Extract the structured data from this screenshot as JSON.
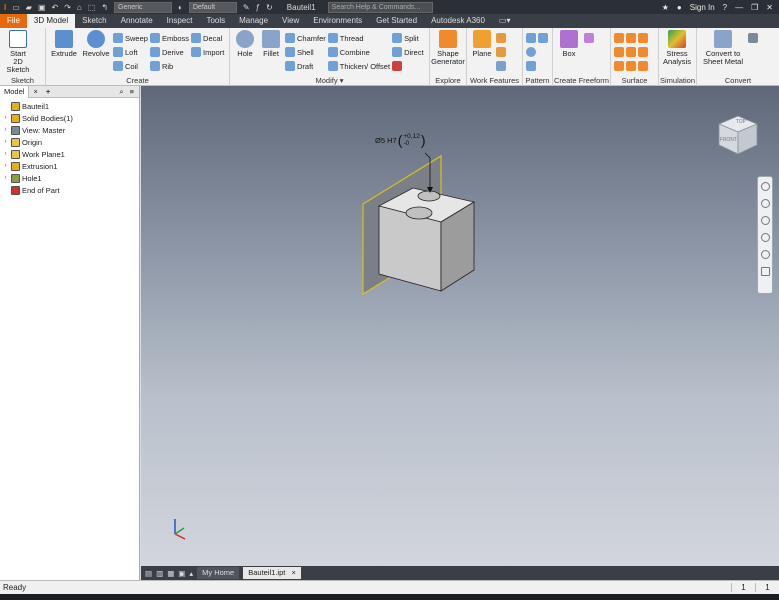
{
  "titlebar": {
    "appearance_select": "Generic",
    "material_select": "Default",
    "doc_title": "Bauteil1",
    "search_placeholder": "Search Help & Commands...",
    "sign_in": "Sign In",
    "help": "?"
  },
  "ribbon_tabs": [
    "File",
    "3D Model",
    "Sketch",
    "Annotate",
    "Inspect",
    "Tools",
    "Manage",
    "View",
    "Environments",
    "Get Started",
    "Autodesk A360"
  ],
  "panels": {
    "sketch": {
      "title": "Sketch",
      "start_label": "Start\n2D Sketch"
    },
    "create": {
      "title": "Create",
      "extrude": "Extrude",
      "revolve": "Revolve",
      "sweep": "Sweep",
      "loft": "Loft",
      "coil": "Coil",
      "emboss": "Emboss",
      "derive": "Derive",
      "rib": "Rib",
      "decal": "Decal",
      "import": "Import"
    },
    "modify": {
      "title": "Modify ▾",
      "hole": "Hole",
      "fillet": "Fillet",
      "chamfer": "Chamfer",
      "shell": "Shell",
      "draft": "Draft",
      "thread": "Thread",
      "combine": "Combine",
      "thicken": "Thicken/ Offset",
      "split": "Split",
      "direct": "Direct"
    },
    "explore": {
      "title": "Explore",
      "shape_generator": "Shape\nGenerator"
    },
    "work_features": {
      "title": "Work Features",
      "plane": "Plane"
    },
    "pattern": {
      "title": "Pattern"
    },
    "freeform": {
      "title": "Create Freeform",
      "box": "Box"
    },
    "surface": {
      "title": "Surface"
    },
    "simulation": {
      "title": "Simulation",
      "stress": "Stress\nAnalysis"
    },
    "convert": {
      "title": "Convert",
      "sheet_metal": "Convert to\nSheet Metal"
    }
  },
  "browser": {
    "tab": "Model",
    "close": "×",
    "add": "+",
    "nodes": [
      {
        "label": "Bauteil1",
        "color": "#e0b020",
        "exp": ""
      },
      {
        "label": "Solid Bodies(1)",
        "color": "#e0b020",
        "exp": "›"
      },
      {
        "label": "View: Master",
        "color": "#7a8a9a",
        "exp": "›"
      },
      {
        "label": "Origin",
        "color": "#e7c44a",
        "exp": "›"
      },
      {
        "label": "Work Plane1",
        "color": "#e7c44a",
        "exp": "›"
      },
      {
        "label": "Extrusion1",
        "color": "#e0b020",
        "exp": "›"
      },
      {
        "label": "Hole1",
        "color": "#8aa040",
        "exp": "›"
      },
      {
        "label": "End of Part",
        "color": "#d03030",
        "exp": ""
      }
    ]
  },
  "viewport": {
    "dimension": "Ø5 H7",
    "tol_upper": "+0,12",
    "tol_lower": "-0",
    "viewcube_face": "FRONT",
    "viewcube_top": "TOP"
  },
  "doc_tabs": {
    "home": "My Home",
    "file": "Bauteil1.ipt",
    "close": "×"
  },
  "status": {
    "text": "Ready",
    "cell1": "1",
    "cell2": "1"
  }
}
